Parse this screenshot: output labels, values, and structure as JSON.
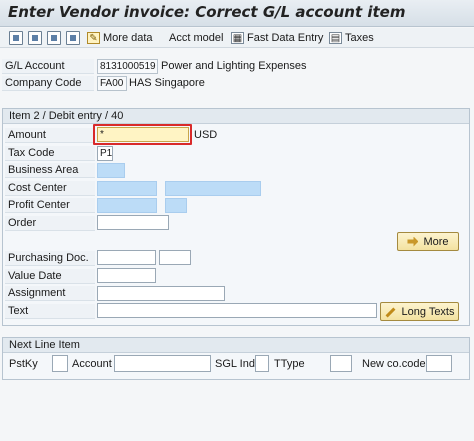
{
  "window": {
    "title": "Enter Vendor invoice: Correct G/L account item"
  },
  "toolbar": {
    "icons": [
      "select-icon",
      "save-icon",
      "copy-icon",
      "document-icon"
    ],
    "more_data": "More data",
    "acct_model": "Acct model",
    "fast_data_entry": "Fast Data Entry",
    "taxes": "Taxes"
  },
  "header": {
    "gl_account_label": "G/L Account",
    "gl_account_value": "8131000519",
    "gl_account_text": "Power and Lighting Expenses",
    "company_code_label": "Company Code",
    "company_code_value": "FA00",
    "company_code_text": "HAS Singapore"
  },
  "item": {
    "group_title": "Item 2 / Debit entry / 40",
    "amount_label": "Amount",
    "amount_value": "*",
    "currency": "USD",
    "tax_code_label": "Tax Code",
    "tax_code_value": "P1",
    "business_area_label": "Business Area",
    "cost_center_label": "Cost Center",
    "profit_center_label": "Profit Center",
    "order_label": "Order",
    "more_button": "More",
    "purchasing_doc_label": "Purchasing Doc.",
    "value_date_label": "Value Date",
    "assignment_label": "Assignment",
    "text_label": "Text",
    "long_texts_button": "Long Texts"
  },
  "next_line": {
    "group_title": "Next Line Item",
    "pstky_label": "PstKy",
    "account_label": "Account",
    "sgl_ind_label": "SGL Ind",
    "ttype_label": "TType",
    "new_cocode_label": "New co.code"
  },
  "colors": {
    "required_field": "#bcdcf7",
    "active_field": "#fff4c4",
    "highlight_border": "#d92a2a"
  }
}
